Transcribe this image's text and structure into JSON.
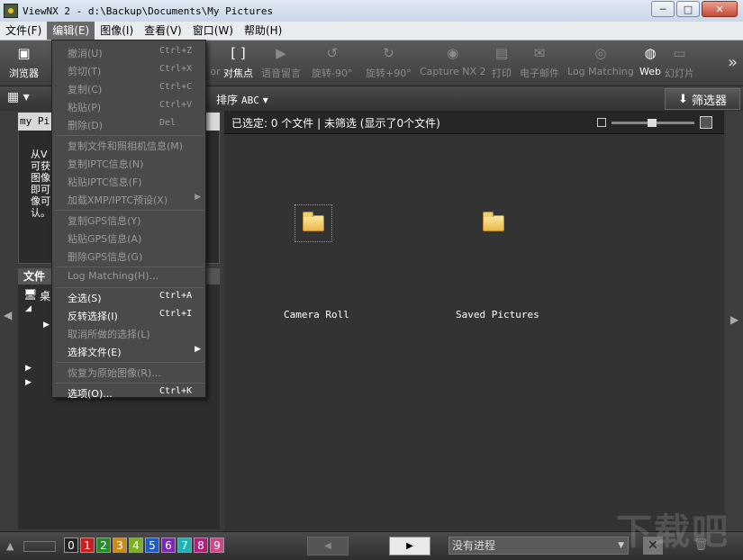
{
  "window": {
    "title": "ViewNX 2 - d:\\Backup\\Documents\\My Pictures",
    "buttons": [
      "─",
      "□",
      "✕"
    ]
  },
  "menubar": [
    {
      "label": "文件(F)"
    },
    {
      "label": "编辑(E)"
    },
    {
      "label": "图像(I)"
    },
    {
      "label": "查看(V)"
    },
    {
      "label": "窗口(W)"
    },
    {
      "label": "帮助(H)"
    }
  ],
  "toolbar": {
    "browser": "浏览器",
    "partial_left": "or",
    "focus_point": "对焦点",
    "voice_memo": "语音留言",
    "rotate_ccw": "旋转-90°",
    "rotate_cw": "旋转+90°",
    "capture_nx2": "Capture NX 2",
    "print": "打印",
    "email": "电子邮件",
    "log_matching": "Log Matching",
    "web": "Web",
    "slideshow": "幻灯片",
    "more": "»"
  },
  "bar2": {
    "sort_label": "排序",
    "sort_value": "ABC",
    "filter_label": "筛选器"
  },
  "left_panel": {
    "pane_title": "my Pi",
    "help_text": "从V 可获 图像 即可 像可 认。",
    "tree_header": "文件",
    "tree_desktop": "桌"
  },
  "main": {
    "status": "已选定: 0 个文件 | 未筛选 (显示了0个文件)",
    "folders": [
      {
        "name": "Camera Roll",
        "selected": true
      },
      {
        "name": "Saved Pictures",
        "selected": false
      }
    ]
  },
  "bottom": {
    "labels": [
      "0",
      "1",
      "2",
      "3",
      "4",
      "5",
      "6",
      "7",
      "8",
      "9"
    ],
    "label_colors": [
      "#222222",
      "#c81e1e",
      "#2a8a2a",
      "#d08a1a",
      "#7ab21e",
      "#1e5ac8",
      "#7a2ab2",
      "#1eb2b2",
      "#b21e7a",
      "#c84a8a"
    ],
    "progress_text": "没有进程"
  },
  "edit_menu": [
    {
      "label": "撤消(U)",
      "shortcut": "Ctrl+Z",
      "enabled": false
    },
    {
      "label": "剪切(T)",
      "shortcut": "Ctrl+X",
      "enabled": false
    },
    {
      "label": "复制(C)",
      "shortcut": "Ctrl+C",
      "enabled": false
    },
    {
      "label": "粘贴(P)",
      "shortcut": "Ctrl+V",
      "enabled": false
    },
    {
      "label": "删除(D)",
      "shortcut": "Del",
      "enabled": false
    },
    {
      "sep": true
    },
    {
      "label": "复制文件和照相机信息(M)",
      "shortcut": "",
      "enabled": false
    },
    {
      "label": "复制IPTC信息(N)",
      "shortcut": "",
      "enabled": false
    },
    {
      "label": "粘贴IPTC信息(F)",
      "shortcut": "",
      "enabled": false
    },
    {
      "label": "加载XMP/IPTC预设(X)",
      "shortcut": "",
      "enabled": false,
      "submenu": true
    },
    {
      "sep": true
    },
    {
      "label": "复制GPS信息(Y)",
      "shortcut": "",
      "enabled": false
    },
    {
      "label": "粘贴GPS信息(A)",
      "shortcut": "",
      "enabled": false
    },
    {
      "label": "删除GPS信息(G)",
      "shortcut": "",
      "enabled": false
    },
    {
      "sep": true
    },
    {
      "label": "Log Matching(H)...",
      "shortcut": "",
      "enabled": false
    },
    {
      "sep": true
    },
    {
      "label": "全选(S)",
      "shortcut": "Ctrl+A",
      "enabled": true
    },
    {
      "label": "反转选择(I)",
      "shortcut": "Ctrl+I",
      "enabled": true
    },
    {
      "label": "取消所做的选择(L)",
      "shortcut": "",
      "enabled": false
    },
    {
      "label": "选择文件(E)",
      "shortcut": "",
      "enabled": true,
      "submenu": true
    },
    {
      "sep": true
    },
    {
      "label": "恢复为原始图像(R)...",
      "shortcut": "",
      "enabled": false
    },
    {
      "sep": true
    },
    {
      "label": "选项(O)...",
      "shortcut": "Ctrl+K",
      "enabled": true
    }
  ],
  "watermark": "下载吧"
}
